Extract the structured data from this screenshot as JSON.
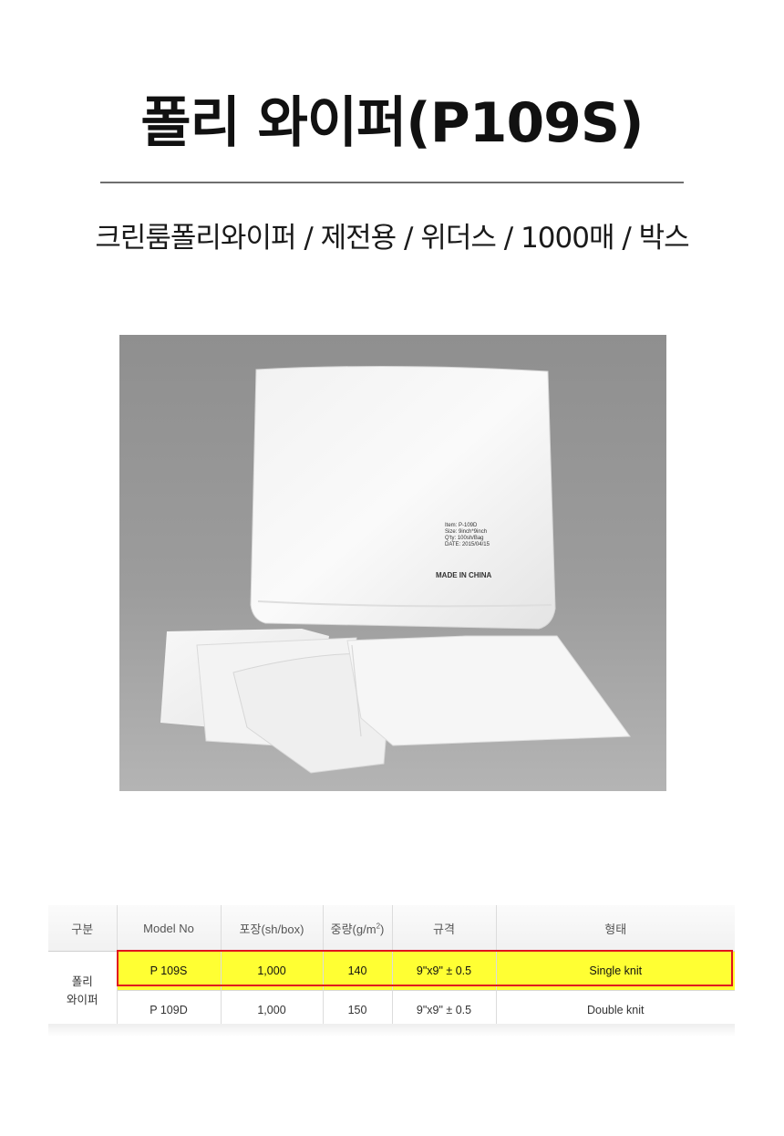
{
  "header": {
    "title": "폴리 와이퍼(P109S)",
    "subtitle": "크린룸폴리와이퍼 / 제전용 / 위더스 / 1000매 / 박스"
  },
  "photo": {
    "bag_label": {
      "item": "Item: P-109D",
      "size": "Size: 9inch*9inch",
      "qty": "Q'ty: 100sh/Bag",
      "date": "DATE:  2015/04/15",
      "origin": "MADE IN CHINA"
    }
  },
  "spec_table": {
    "headers": {
      "category": "구분",
      "model": "Model No",
      "packing": "포장(sh/box)",
      "weight": "중량(g/m",
      "weight_sup": "2",
      "weight_close": ")",
      "size": "규격",
      "type": "형태"
    },
    "group_label_line1": "폴리",
    "group_label_line2": "와이퍼",
    "rows": [
      {
        "model": "P 109S",
        "packing": "1,000",
        "weight": "140",
        "size": "9\"x9\" ± 0.5",
        "type": "Single knit",
        "highlighted": true
      },
      {
        "model": "P 109D",
        "packing": "1,000",
        "weight": "150",
        "size": "9\"x9\" ± 0.5",
        "type": "Double knit",
        "highlighted": false
      }
    ]
  },
  "colors": {
    "highlight_fill": "#ffff33",
    "highlight_border": "#e0141e",
    "photo_background": "#8a8a8a"
  }
}
